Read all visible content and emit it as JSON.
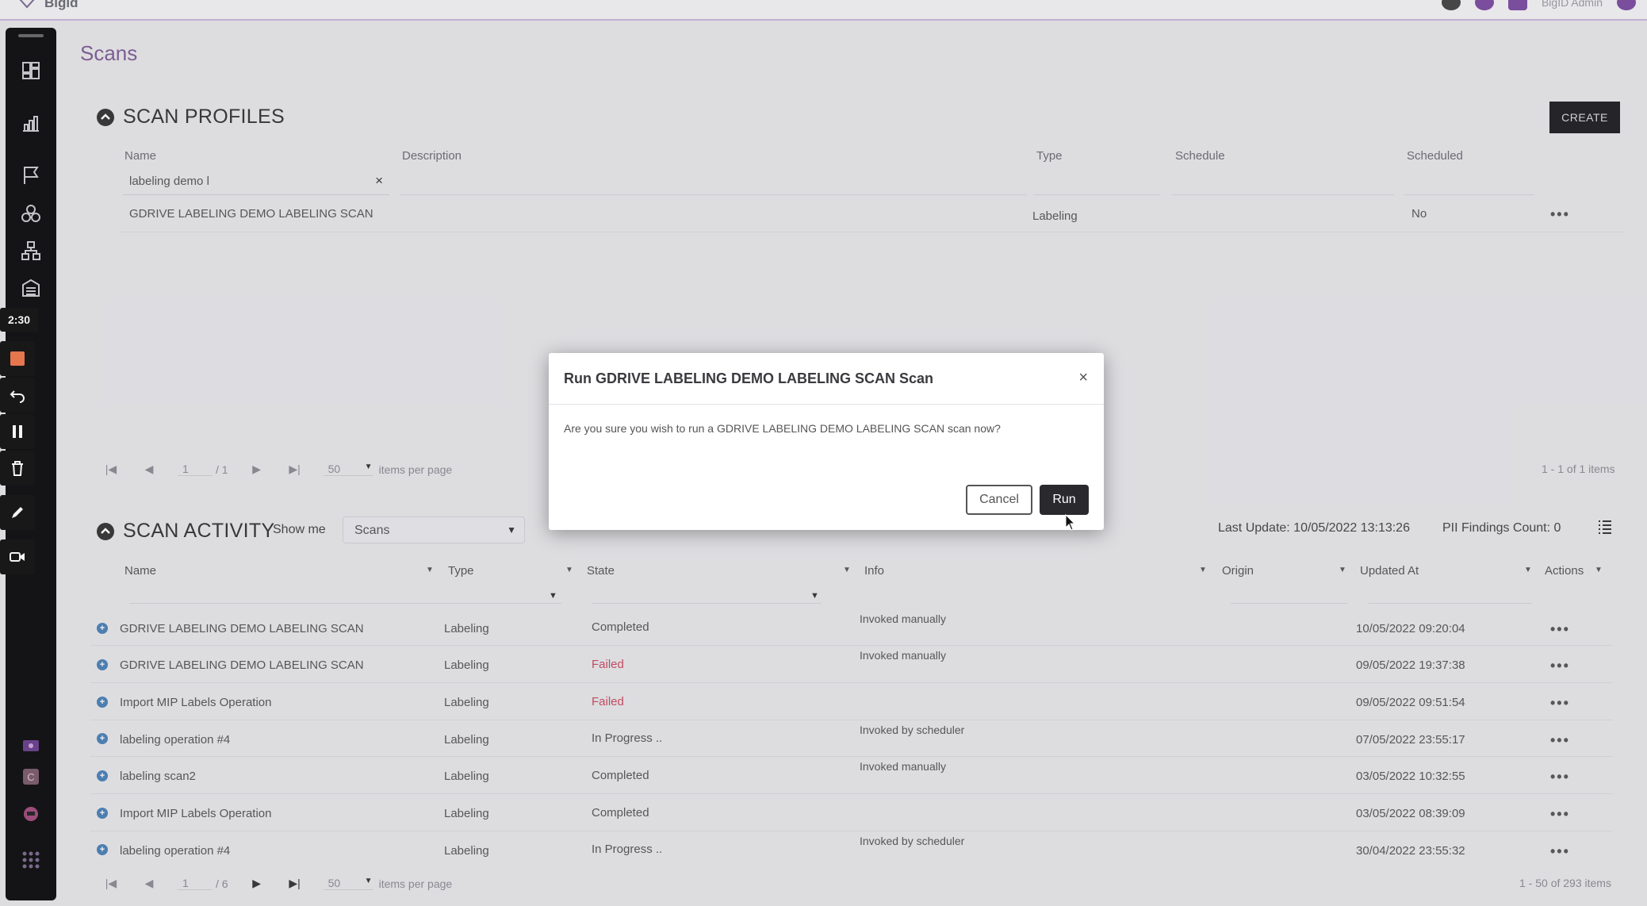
{
  "topbar": {
    "brand": "Bigid",
    "user": "BigID Admin"
  },
  "page": {
    "title": "Scans"
  },
  "profiles": {
    "title": "SCAN PROFILES",
    "create_label": "CREATE",
    "columns": [
      "Name",
      "Description",
      "Type",
      "Schedule",
      "Scheduled"
    ],
    "filter_value": "labeling demo l",
    "filter_clear": "×",
    "rows": [
      {
        "name": "GDRIVE LABELING DEMO LABELING SCAN",
        "type": "Labeling",
        "scheduled": "No",
        "actions": "•••"
      }
    ],
    "pager": {
      "page": "1",
      "of": "/ 1",
      "per_page": "50",
      "per_page_label": "items per page",
      "summary": "1 - 1 of 1 items"
    }
  },
  "activity": {
    "title": "SCAN ACTIVITY",
    "show_me_label": "Show me",
    "show_me_value": "Scans",
    "last_update": "Last Update: 10/05/2022 13:13:26",
    "pii_count": "PII Findings Count: 0",
    "columns": [
      "Name",
      "Type",
      "State",
      "Info",
      "Origin",
      "Updated At",
      "Actions"
    ],
    "rows": [
      {
        "name": "GDRIVE LABELING DEMO LABELING SCAN",
        "type": "Labeling",
        "state": "Completed",
        "info": "Invoked manually",
        "updated": "10/05/2022 09:20:04",
        "actions": "•••"
      },
      {
        "name": "GDRIVE LABELING DEMO LABELING SCAN",
        "type": "Labeling",
        "state": "Failed",
        "info": "Invoked manually",
        "updated": "09/05/2022 19:37:38",
        "actions": "•••"
      },
      {
        "name": "Import MIP Labels Operation",
        "type": "Labeling",
        "state": "Failed",
        "info": "",
        "updated": "09/05/2022 09:51:54",
        "actions": "•••"
      },
      {
        "name": "labeling operation #4",
        "type": "Labeling",
        "state": "In Progress ..",
        "info": "Invoked by scheduler",
        "updated": "07/05/2022 23:55:17",
        "actions": "•••"
      },
      {
        "name": "labeling scan2",
        "type": "Labeling",
        "state": "Completed",
        "info": "Invoked manually",
        "updated": "03/05/2022 10:32:55",
        "actions": "•••"
      },
      {
        "name": "Import MIP Labels Operation",
        "type": "Labeling",
        "state": "Completed",
        "info": "",
        "updated": "03/05/2022 08:39:09",
        "actions": "•••"
      },
      {
        "name": "labeling operation #4",
        "type": "Labeling",
        "state": "In Progress ..",
        "info": "Invoked by scheduler",
        "updated": "30/04/2022 23:55:32",
        "actions": "•••"
      }
    ],
    "pager": {
      "page": "1",
      "of": "/ 6",
      "per_page": "50",
      "per_page_label": "items per page",
      "summary": "1 - 50 of 293 items"
    }
  },
  "modal": {
    "title": "Run GDRIVE LABELING DEMO LABELING SCAN Scan",
    "close": "×",
    "body": "Are you sure you wish to run a GDRIVE LABELING DEMO LABELING SCAN scan now?",
    "cancel_label": "Cancel",
    "run_label": "Run"
  },
  "recorder": {
    "timer": "2:30"
  },
  "colors": {
    "accent": "#7e5c94",
    "failed": "#c8485e",
    "nav_bg": "#0c0c0e"
  }
}
